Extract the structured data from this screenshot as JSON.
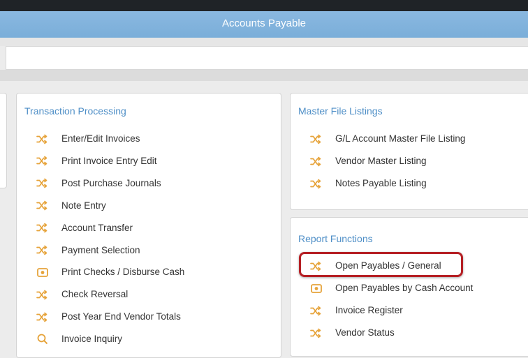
{
  "header": {
    "title": "Accounts Payable"
  },
  "colors": {
    "accent": "#4f8fc7",
    "icon": "#e6a33a",
    "highlight": "#b51f24",
    "titlebar": "#7aaed9"
  },
  "transaction_processing": {
    "title": "Transaction Processing",
    "items": [
      {
        "label": "Enter/Edit Invoices",
        "icon": "shuffle-icon"
      },
      {
        "label": "Print Invoice Entry Edit",
        "icon": "shuffle-icon"
      },
      {
        "label": "Post Purchase Journals",
        "icon": "shuffle-icon"
      },
      {
        "label": "Note Entry",
        "icon": "shuffle-icon"
      },
      {
        "label": "Account Transfer",
        "icon": "shuffle-icon"
      },
      {
        "label": "Payment Selection",
        "icon": "shuffle-icon"
      },
      {
        "label": "Print Checks / Disburse Cash",
        "icon": "money-icon"
      },
      {
        "label": "Check Reversal",
        "icon": "shuffle-icon"
      },
      {
        "label": "Post Year End Vendor Totals",
        "icon": "shuffle-icon"
      },
      {
        "label": "Invoice Inquiry",
        "icon": "search-icon"
      }
    ]
  },
  "master_file_listings": {
    "title": "Master File Listings",
    "items": [
      {
        "label": "G/L Account Master File Listing",
        "icon": "shuffle-icon"
      },
      {
        "label": "Vendor Master Listing",
        "icon": "shuffle-icon"
      },
      {
        "label": "Notes Payable Listing",
        "icon": "shuffle-icon"
      }
    ]
  },
  "report_functions": {
    "title": "Report Functions",
    "items": [
      {
        "label": "Open Payables / General",
        "icon": "shuffle-icon"
      },
      {
        "label": "Open Payables by Cash Account",
        "icon": "money-icon"
      },
      {
        "label": "Invoice Register",
        "icon": "shuffle-icon"
      },
      {
        "label": "Vendor Status",
        "icon": "shuffle-icon"
      }
    ]
  }
}
